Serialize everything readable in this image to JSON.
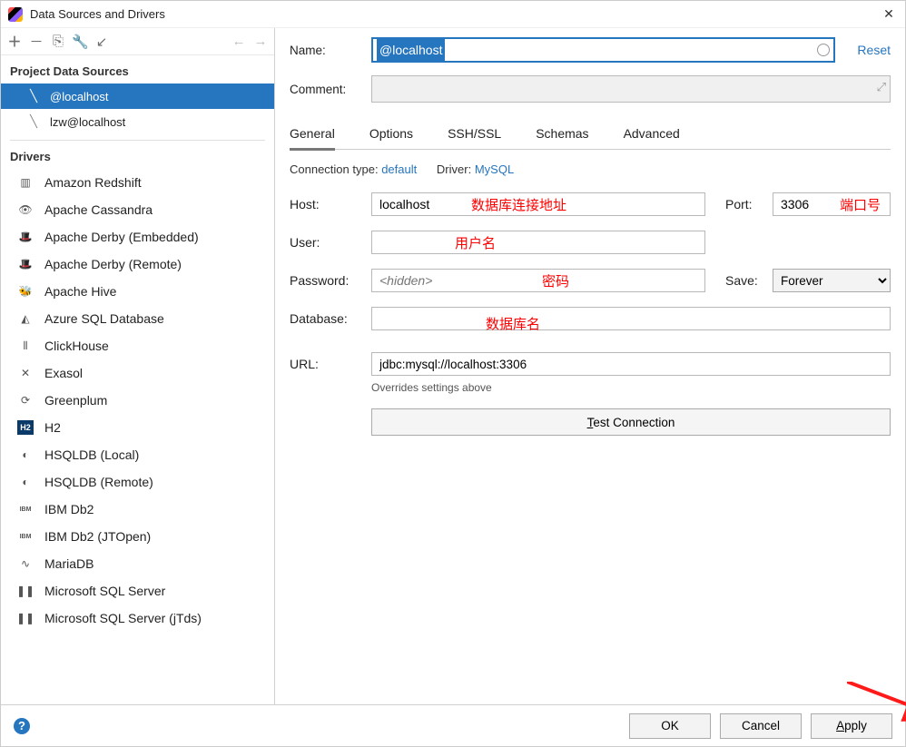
{
  "window": {
    "title": "Data Sources and Drivers"
  },
  "sidebar": {
    "project_header": "Project Data Sources",
    "items": [
      {
        "label": "@localhost",
        "selected": true
      },
      {
        "label": "lzw@localhost",
        "selected": false
      }
    ],
    "drivers_header": "Drivers",
    "drivers": [
      {
        "label": "Amazon Redshift",
        "glyph": "▥"
      },
      {
        "label": "Apache Cassandra",
        "glyph": "👁"
      },
      {
        "label": "Apache Derby (Embedded)",
        "glyph": "🎩"
      },
      {
        "label": "Apache Derby (Remote)",
        "glyph": "🎩"
      },
      {
        "label": "Apache Hive",
        "glyph": "🐝"
      },
      {
        "label": "Azure SQL Database",
        "glyph": "◭"
      },
      {
        "label": "ClickHouse",
        "glyph": "⦀"
      },
      {
        "label": "Exasol",
        "glyph": "✕"
      },
      {
        "label": "Greenplum",
        "glyph": "⟳"
      },
      {
        "label": "H2",
        "glyph": "H2"
      },
      {
        "label": "HSQLDB (Local)",
        "glyph": "◐"
      },
      {
        "label": "HSQLDB (Remote)",
        "glyph": "◐"
      },
      {
        "label": "IBM Db2",
        "glyph": "IBM"
      },
      {
        "label": "IBM Db2 (JTOpen)",
        "glyph": "IBM"
      },
      {
        "label": "MariaDB",
        "glyph": "∿"
      },
      {
        "label": "Microsoft SQL Server",
        "glyph": "❚❚"
      },
      {
        "label": "Microsoft SQL Server (jTds)",
        "glyph": "❚❚"
      }
    ]
  },
  "form": {
    "name_label": "Name:",
    "name_value": "@localhost",
    "reset": "Reset",
    "comment_label": "Comment:",
    "tabs": [
      {
        "label": "General",
        "active": true
      },
      {
        "label": "Options",
        "active": false
      },
      {
        "label": "SSH/SSL",
        "active": false
      },
      {
        "label": "Schemas",
        "active": false
      },
      {
        "label": "Advanced",
        "active": false
      }
    ],
    "conn_type_label": "Connection type:",
    "conn_type_value": "default",
    "driver_label": "Driver:",
    "driver_value": "MySQL",
    "host_label": "Host:",
    "host_value": "localhost",
    "port_label": "Port:",
    "port_value": "3306",
    "user_label": "User:",
    "user_value": "",
    "password_label": "Password:",
    "password_placeholder": "<hidden>",
    "save_label": "Save:",
    "save_value": "Forever",
    "database_label": "Database:",
    "database_value": "",
    "url_label": "URL:",
    "url_value": "jdbc:mysql://localhost:3306",
    "url_hint": "Overrides settings above",
    "test_label": "est Connection",
    "test_underline": "T"
  },
  "annotations": {
    "host": "数据库连接地址",
    "port": "端口号",
    "user": "用户名",
    "password": "密码",
    "database": "数据库名"
  },
  "footer": {
    "ok": "OK",
    "cancel": "Cancel",
    "apply": "pply",
    "apply_underline": "A"
  }
}
